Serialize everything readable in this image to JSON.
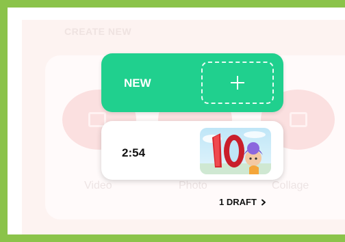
{
  "background": {
    "title": "CREATE NEW",
    "options": [
      "Video",
      "Photo",
      "Collage"
    ]
  },
  "new_card": {
    "label": "NEW",
    "icon": "plus-icon",
    "color": "#20d08e"
  },
  "draft_card": {
    "duration": "2:54",
    "thumbnail_icon": "video-thumbnail"
  },
  "drafts_link": {
    "label": "1 DRAFT",
    "icon": "chevron-right-icon"
  },
  "colors": {
    "frame_border": "#8bc34a",
    "accent": "#20d08e"
  }
}
